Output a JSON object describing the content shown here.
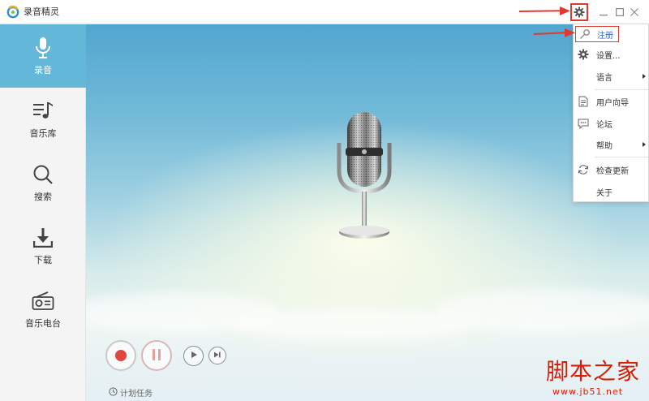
{
  "window": {
    "title": "录音精灵"
  },
  "sidebar": {
    "items": [
      {
        "label": "录音",
        "icon": "microphone-icon",
        "active": true
      },
      {
        "label": "音乐库",
        "icon": "music-list-icon",
        "active": false
      },
      {
        "label": "搜索",
        "icon": "search-icon",
        "active": false
      },
      {
        "label": "下载",
        "icon": "download-icon",
        "active": false
      },
      {
        "label": "音乐电台",
        "icon": "radio-icon",
        "active": false
      }
    ]
  },
  "player": {
    "schedule_label": "计划任务"
  },
  "menu": {
    "items": [
      {
        "label": "注册",
        "icon": "key-icon"
      },
      {
        "label": "设置...",
        "icon": "gear-icon"
      },
      {
        "label": "语言",
        "icon": "",
        "submenu": true
      },
      {
        "label": "用户向导",
        "icon": "document-icon"
      },
      {
        "label": "论坛",
        "icon": "chat-icon"
      },
      {
        "label": "帮助",
        "icon": "",
        "submenu": true
      },
      {
        "label": "检查更新",
        "icon": "refresh-icon"
      },
      {
        "label": "关于",
        "icon": ""
      }
    ]
  },
  "watermark": {
    "text": "脚本之家",
    "url": "www.jb51.net"
  },
  "colors": {
    "active_nav": "#63b7d8",
    "record_red": "#e0473f",
    "annotation_red": "#e03a2f",
    "register_blue": "#2a6ad0",
    "watermark_red": "#d81e06"
  }
}
